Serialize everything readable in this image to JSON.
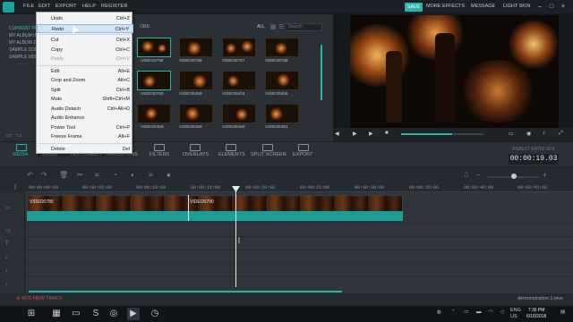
{
  "menubar": {
    "file": "FILE",
    "edit": "EDIT",
    "export": "EXPORT",
    "help": "HELP",
    "register": "REGISTER"
  },
  "topright": {
    "save": "SAVE",
    "more_effects": "MORE EFFECTS",
    "message": "MESSAGE",
    "light_skin": "LIGHT SKIN"
  },
  "library": {
    "current_item": "CURRENT PR...",
    "items": [
      "MY ALBUM (0)",
      "MY ALBUM 2",
      "SAMPLE COL...",
      "SAMPLE VIDE..."
    ],
    "record_label": "ORD",
    "all_label": "ALL",
    "search_placeholder": "Search",
    "thumbs": [
      [
        "VIDEO0785",
        "VIDEO0786",
        "VIDEO0787",
        "VIDEO0788"
      ],
      [
        "VIDEO0790",
        "VIDEO0459",
        "VIDEO0434",
        "VIDEO0456"
      ],
      [
        "VIDEO0458",
        "VIDEO0459",
        "VIDEO0460",
        "VIDEO0461"
      ]
    ]
  },
  "tabs": [
    "MEDIA",
    "MUSIC",
    "TEXT/CREDIT",
    "TRANSITIONS",
    "FILTERS",
    "OVERLAYS",
    "ELEMENTS",
    "SPLIT SCREEN",
    "EXPORT"
  ],
  "aspect_label": "ASPECT RATIO 16:9",
  "timecode": "00:00:19.03",
  "ruler": [
    "00:00:00:00",
    "00:00:05:00",
    "00:00:10:00",
    "00:00:15:00",
    "00:00:20:00",
    "00:00:25:00",
    "00:00:30:00",
    "00:00:35:00",
    "00:00:40:00",
    "00:00:45:00"
  ],
  "clips": {
    "first": "VIDEO0785",
    "second": "VIDEO0790"
  },
  "add_track": "ADD NEW TRACK",
  "project_name": "demonstration 1.wve",
  "edit_menu": [
    {
      "label": "Undo",
      "shortcut": "Ctrl+Z",
      "disabled": false
    },
    {
      "label": "Redo",
      "shortcut": "Ctrl+Y",
      "disabled": false,
      "highlighted": true
    },
    {
      "sep": true
    },
    {
      "label": "Cut",
      "shortcut": "Ctrl+X",
      "disabled": false
    },
    {
      "label": "Copy",
      "shortcut": "Ctrl+C",
      "disabled": false
    },
    {
      "label": "Paste",
      "shortcut": "Ctrl+V",
      "disabled": true
    },
    {
      "sep": true
    },
    {
      "label": "Edit",
      "shortcut": "Alt+E",
      "disabled": false
    },
    {
      "label": "Crop and Zoom",
      "shortcut": "Alt+C",
      "disabled": false
    },
    {
      "label": "Split",
      "shortcut": "Ctrl+B",
      "disabled": false
    },
    {
      "label": "Mute",
      "shortcut": "Shift+Ctrl+M",
      "disabled": false
    },
    {
      "label": "Audio Detach",
      "shortcut": "Ctrl+Alt+D",
      "disabled": false
    },
    {
      "label": "Audio Enhance",
      "shortcut": "",
      "disabled": false
    },
    {
      "label": "Power Tool",
      "shortcut": "Ctrl+P",
      "disabled": false
    },
    {
      "label": "Freeze Frame",
      "shortcut": "Alt+F",
      "disabled": false
    },
    {
      "sep": true
    },
    {
      "label": "Delete",
      "shortcut": "Del",
      "disabled": false
    }
  ],
  "taskbar": {
    "lang1": "ENG",
    "lang2": "US",
    "time": "7:36 PM",
    "date": "6/15/2018"
  },
  "colors": {
    "accent": "#26b5a8",
    "add_track": "#c64f57"
  }
}
